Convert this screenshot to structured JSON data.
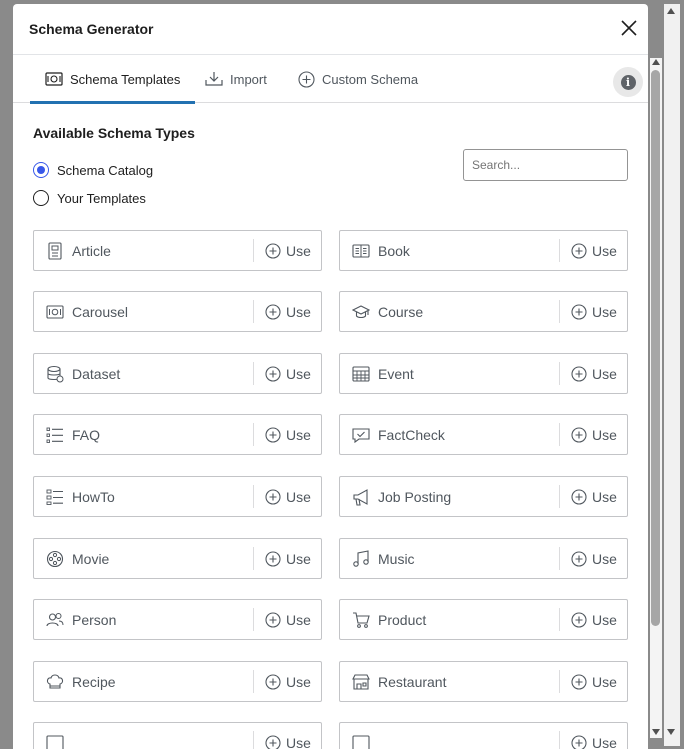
{
  "modal": {
    "title": "Schema Generator"
  },
  "tabs": [
    {
      "label": "Schema Templates",
      "icon": "template-icon",
      "active": true
    },
    {
      "label": "Import",
      "icon": "import-icon",
      "active": false
    },
    {
      "label": "Custom Schema",
      "icon": "plus-circle-icon",
      "active": false
    }
  ],
  "section": {
    "title": "Available Schema Types"
  },
  "radios": [
    {
      "label": "Schema Catalog",
      "checked": true
    },
    {
      "label": "Your Templates",
      "checked": false
    }
  ],
  "search": {
    "placeholder": "Search..."
  },
  "use_label": "Use",
  "schemas": [
    {
      "label": "Article",
      "icon": "article-icon"
    },
    {
      "label": "Book",
      "icon": "book-icon"
    },
    {
      "label": "Carousel",
      "icon": "carousel-icon"
    },
    {
      "label": "Course",
      "icon": "graduation-cap-icon"
    },
    {
      "label": "Dataset",
      "icon": "database-icon"
    },
    {
      "label": "Event",
      "icon": "calendar-icon"
    },
    {
      "label": "FAQ",
      "icon": "list-icon"
    },
    {
      "label": "FactCheck",
      "icon": "chat-check-icon"
    },
    {
      "label": "HowTo",
      "icon": "steps-list-icon"
    },
    {
      "label": "Job Posting",
      "icon": "megaphone-icon"
    },
    {
      "label": "Movie",
      "icon": "film-reel-icon"
    },
    {
      "label": "Music",
      "icon": "music-note-icon"
    },
    {
      "label": "Person",
      "icon": "people-icon"
    },
    {
      "label": "Product",
      "icon": "cart-icon"
    },
    {
      "label": "Recipe",
      "icon": "chef-hat-icon"
    },
    {
      "label": "Restaurant",
      "icon": "storefront-icon"
    },
    {
      "label": "",
      "icon": "partial-icon"
    },
    {
      "label": "",
      "icon": "partial-icon"
    }
  ],
  "colors": {
    "accent": "#2271b1",
    "radio_accent": "#3858e9",
    "text": "#1e1e1e",
    "muted": "#50575e"
  }
}
